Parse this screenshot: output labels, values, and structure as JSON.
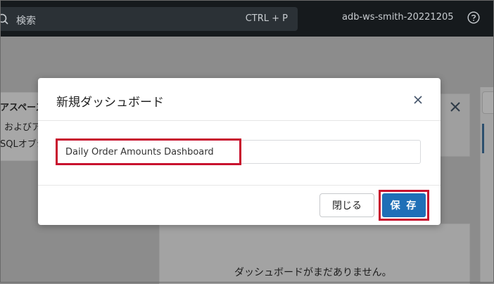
{
  "topbar": {
    "search_placeholder": "検索",
    "search_shortcut": "CTRL + P",
    "username": "adb-ws-smith-20221205",
    "icons": {
      "search": "search-icon",
      "help": "help-icon"
    }
  },
  "background": {
    "left_card_lines": [
      "アスペース",
      "およびア",
      "SQLオブジ"
    ],
    "empty_message": "ダッシュボードがまだありません。"
  },
  "modal": {
    "title": "新規ダッシュボード",
    "name_value": "Daily Order Amounts Dashboard",
    "close_label": "閉じる",
    "save_label": "保 存"
  },
  "colors": {
    "topbar": "#161a1d",
    "save_button": "#1f6fb7",
    "highlight": "#c8102e"
  }
}
